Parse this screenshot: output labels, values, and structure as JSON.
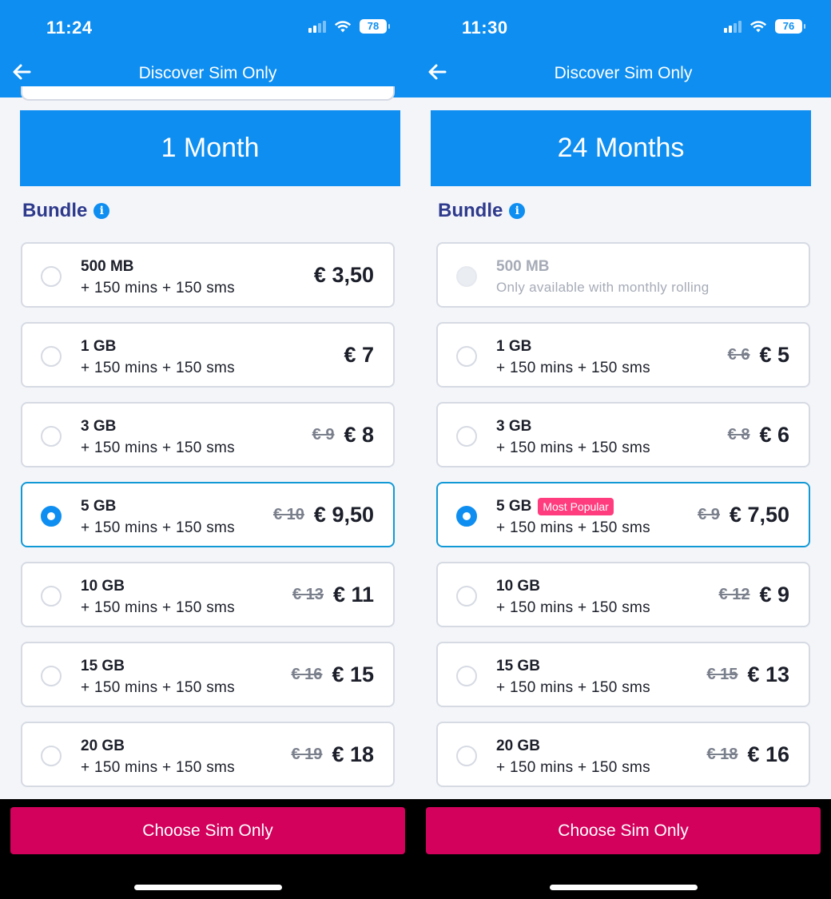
{
  "screens": [
    {
      "time": "11:24",
      "battery": "78",
      "signal_bars_active": 2,
      "nav_title": "Discover Sim Only",
      "duration": "1 Month",
      "section_title": "Bundle",
      "cta": "Choose Sim Only",
      "bundles": [
        {
          "name": "500 MB",
          "detail": "+ 150 mins + 150 sms",
          "old_price": "",
          "price": "€ 3,50",
          "state": "unselected",
          "badge": ""
        },
        {
          "name": "1 GB",
          "detail": "+ 150 mins + 150 sms",
          "old_price": "",
          "price": "€ 7",
          "state": "unselected",
          "badge": ""
        },
        {
          "name": "3 GB",
          "detail": "+ 150 mins + 150 sms",
          "old_price": "€ 9",
          "price": "€ 8",
          "state": "unselected",
          "badge": ""
        },
        {
          "name": "5 GB",
          "detail": "+ 150 mins + 150 sms",
          "old_price": "€ 10",
          "price": "€ 9,50",
          "state": "selected",
          "badge": ""
        },
        {
          "name": "10 GB",
          "detail": "+ 150 mins + 150 sms",
          "old_price": "€ 13",
          "price": "€ 11",
          "state": "unselected",
          "badge": ""
        },
        {
          "name": "15 GB",
          "detail": "+ 150 mins + 150 sms",
          "old_price": "€ 16",
          "price": "€ 15",
          "state": "unselected",
          "badge": ""
        },
        {
          "name": "20 GB",
          "detail": "+ 150 mins + 150 sms",
          "old_price": "€ 19",
          "price": "€ 18",
          "state": "unselected",
          "badge": ""
        }
      ]
    },
    {
      "time": "11:30",
      "battery": "76",
      "signal_bars_active": 2,
      "nav_title": "Discover Sim Only",
      "duration": "24 Months",
      "section_title": "Bundle",
      "cta": "Choose Sim Only",
      "bundles": [
        {
          "name": "500 MB",
          "detail": "Only available with monthly rolling",
          "old_price": "",
          "price": "",
          "state": "disabled",
          "badge": ""
        },
        {
          "name": "1 GB",
          "detail": "+ 150 mins + 150 sms",
          "old_price": "€ 6",
          "price": "€ 5",
          "state": "unselected",
          "badge": ""
        },
        {
          "name": "3 GB",
          "detail": "+ 150 mins + 150 sms",
          "old_price": "€ 8",
          "price": "€ 6",
          "state": "unselected",
          "badge": ""
        },
        {
          "name": "5 GB",
          "detail": "+ 150 mins + 150 sms",
          "old_price": "€ 9",
          "price": "€ 7,50",
          "state": "selected",
          "badge": "Most Popular"
        },
        {
          "name": "10 GB",
          "detail": "+ 150 mins + 150 sms",
          "old_price": "€ 12",
          "price": "€ 9",
          "state": "unselected",
          "badge": ""
        },
        {
          "name": "15 GB",
          "detail": "+ 150 mins + 150 sms",
          "old_price": "€ 15",
          "price": "€ 13",
          "state": "unselected",
          "badge": ""
        },
        {
          "name": "20 GB",
          "detail": "+ 150 mins + 150 sms",
          "old_price": "€ 18",
          "price": "€ 16",
          "state": "unselected",
          "badge": ""
        }
      ]
    }
  ],
  "colors": {
    "header_blue": "#0e8ef0",
    "cta_magenta": "#d3005c",
    "badge_pink": "#ff3c7e",
    "title_navy": "#2e3a8c"
  },
  "icons": {
    "back": "arrow-left-icon",
    "info": "info-icon",
    "wifi": "wifi-icon",
    "signal": "signal-icon",
    "battery": "battery-icon"
  }
}
